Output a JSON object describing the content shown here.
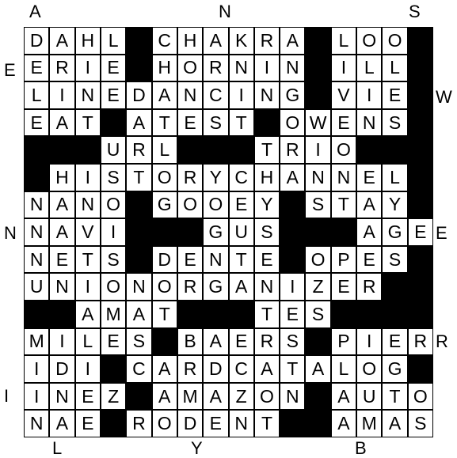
{
  "puzzle": {
    "rows": [
      "DAHL#CHAKRA#LOO",
      "ERIE#HORNIN#ILL",
      "LINEDANCING#VIE",
      "EAT#ATEST#OWENS",
      "###URL###TRIO##",
      "#HISTORYCHANNEL",
      "NANO#GOOEY#STAY",
      "NAVI###GUS###AGE",
      "NETS#DENTE#OPES",
      "UNIONORGANIZER#",
      "##AMAT###TES###",
      "MILES#BAERS#PIER",
      "IDI#CARDCATALOG",
      "INEZ#AMAZON#AUTO",
      "NAE#RODENT##AMAS"
    ]
  },
  "edge_labels": {
    "top": [
      "A",
      "N",
      "S"
    ],
    "left": [
      "E",
      "N",
      "I"
    ],
    "right": [
      "W",
      "E",
      "R"
    ],
    "bottom": [
      "L",
      "Y",
      "B"
    ]
  }
}
